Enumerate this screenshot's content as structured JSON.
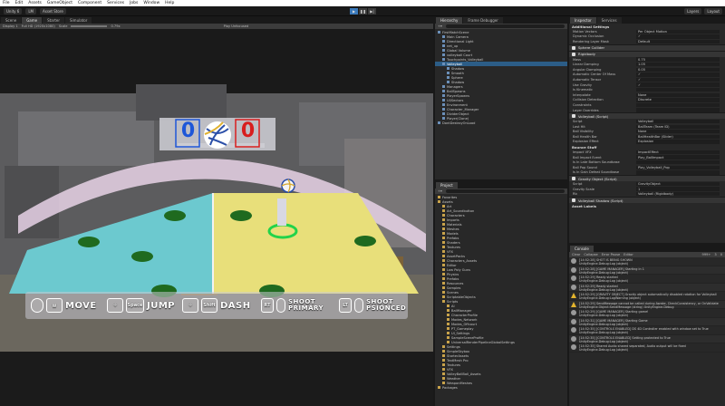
{
  "menu": [
    "File",
    "Edit",
    "Assets",
    "GameObject",
    "Component",
    "Services",
    "Jobs",
    "Window",
    "Help"
  ],
  "toolbar": {
    "account": "Unity 6",
    "cloud": "LM",
    "asset_store": "Asset Store",
    "layers": "Layers",
    "layout": "Layout"
  },
  "scene_tabs": [
    "Scene",
    "Game",
    "Starter",
    "Simulator"
  ],
  "game_bar": {
    "display": "Display 1",
    "resolution": "Full HD (1920x1080)",
    "scale_label": "Scale",
    "scale_value": "0.79x",
    "play_focused": "Play Unfocused"
  },
  "hud": {
    "score_left": "0",
    "score_right": "0",
    "move": "MOVE",
    "jump_key": "Space",
    "jump": "JUMP",
    "dash_key": "Shift",
    "dash": "DASH",
    "rt": "RT",
    "shoot_primary_1": "SHOOT",
    "shoot_primary_2": "PRIMARY",
    "lt": "LT",
    "shoot_2_1": "SHOOT",
    "shoot_2_2": "PSIONCED",
    "colors": {
      "blue": "#1e57d8",
      "red": "#d81e1e",
      "court_left": "#6cc9cf",
      "court_right": "#e8df7a",
      "pad": "#1f6a1f",
      "ring": "#22d34a"
    }
  },
  "hierarchy": {
    "tabs": [
      "Hierarchy",
      "Frame Debugger"
    ],
    "rows": [
      {
        "label": "FirstMatchScene",
        "depth": 0
      },
      {
        "label": "Main Camera",
        "depth": 1
      },
      {
        "label": "Directional Light",
        "depth": 1
      },
      {
        "label": "net_up",
        "depth": 1
      },
      {
        "label": "Global Volume",
        "depth": 1
      },
      {
        "label": "volleyball Court",
        "depth": 1
      },
      {
        "label": "Touchpoints_Volleyball",
        "depth": 1
      },
      {
        "label": "Volleyball",
        "depth": 1
      },
      {
        "label": "Shadow",
        "depth": 2
      },
      {
        "label": "Smooth",
        "depth": 2
      },
      {
        "label": "Sphere",
        "depth": 2
      },
      {
        "label": "Shadow",
        "depth": 2
      },
      {
        "label": "Managers",
        "depth": 1
      },
      {
        "label": "BallSpawns",
        "depth": 1
      },
      {
        "label": "PlayerSpawns",
        "depth": 1
      },
      {
        "label": "UI/Sectors",
        "depth": 1
      },
      {
        "label": "Environment",
        "depth": 1
      },
      {
        "label": "Character_Manager",
        "depth": 1
      },
      {
        "label": "DividerObject",
        "depth": 1
      },
      {
        "label": "Player(Clone)",
        "depth": 1
      },
      {
        "label": "DontDestroyOnLoad",
        "depth": 0
      }
    ]
  },
  "project": {
    "tabs": [
      "Project",
      "Console"
    ],
    "search_placeholder": "",
    "rows": [
      {
        "label": "Favorites",
        "depth": 0
      },
      {
        "label": "Assets",
        "depth": 0
      },
      {
        "label": "Art",
        "depth": 1
      },
      {
        "label": "Art_Soundbutton",
        "depth": 1
      },
      {
        "label": "Characters",
        "depth": 1
      },
      {
        "label": "Imports",
        "depth": 1
      },
      {
        "label": "Materials",
        "depth": 1
      },
      {
        "label": "Meshes",
        "depth": 1
      },
      {
        "label": "Models",
        "depth": 1
      },
      {
        "label": "Prefabs",
        "depth": 1
      },
      {
        "label": "Shaders",
        "depth": 1
      },
      {
        "label": "Textures",
        "depth": 1
      },
      {
        "label": "VFX",
        "depth": 1
      },
      {
        "label": "AssetPacks",
        "depth": 1
      },
      {
        "label": "Characters_Assets",
        "depth": 1
      },
      {
        "label": "Editor",
        "depth": 1
      },
      {
        "label": "Low Poly Guns",
        "depth": 1
      },
      {
        "label": "Physics",
        "depth": 1
      },
      {
        "label": "Prefabs",
        "depth": 1
      },
      {
        "label": "Resources",
        "depth": 1
      },
      {
        "label": "Samples",
        "depth": 1
      },
      {
        "label": "Scenes",
        "depth": 1
      },
      {
        "label": "ScriptableObjects",
        "depth": 1
      },
      {
        "label": "Scripts",
        "depth": 1
      },
      {
        "label": "AI",
        "depth": 2
      },
      {
        "label": "BallManager",
        "depth": 2
      },
      {
        "label": "CharacterProfile",
        "depth": 2
      },
      {
        "label": "Modes_Network",
        "depth": 2
      },
      {
        "label": "Modes_Offcourt",
        "depth": 2
      },
      {
        "label": "PT_Gameplay",
        "depth": 2
      },
      {
        "label": "UI_Settings",
        "depth": 2
      },
      {
        "label": "SampleSceneProfile",
        "depth": 2
      },
      {
        "label": "UniversalRenderPipelineGlobalSettings",
        "depth": 2
      },
      {
        "label": "Settings",
        "depth": 1
      },
      {
        "label": "SimpleSkybox",
        "depth": 1
      },
      {
        "label": "StarterAssets",
        "depth": 1
      },
      {
        "label": "TextMesh Pro",
        "depth": 1
      },
      {
        "label": "Textures",
        "depth": 1
      },
      {
        "label": "VFX",
        "depth": 1
      },
      {
        "label": "VolleyBallBall_Assets",
        "depth": 1
      },
      {
        "label": "Weather",
        "depth": 1
      },
      {
        "label": "WeaponMeshes",
        "depth": 1
      },
      {
        "label": "Packages",
        "depth": 0
      }
    ]
  },
  "inspector": {
    "tabs": [
      "Inspector",
      "Services"
    ],
    "sections": [
      {
        "type": "head",
        "label": "Additional Settings"
      },
      {
        "type": "row",
        "k": "Motion Vectors",
        "v": "Per Object Motion"
      },
      {
        "type": "row",
        "k": "Dynamic Occlusion",
        "v": "✓"
      },
      {
        "type": "row",
        "k": "Rendering Layer Mask",
        "v": "Default"
      },
      {
        "type": "comp",
        "label": "Sphere Collider"
      },
      {
        "type": "comp",
        "label": "Rigidbody"
      },
      {
        "type": "row",
        "k": "Mass",
        "v": "0.75"
      },
      {
        "type": "row",
        "k": "Linear Damping",
        "v": "1.05"
      },
      {
        "type": "row",
        "k": "Angular Damping",
        "v": "0.05"
      },
      {
        "type": "row",
        "k": "Automatic Center Of Mass",
        "v": "✓"
      },
      {
        "type": "row",
        "k": "Automatic Tensor",
        "v": "✓"
      },
      {
        "type": "row",
        "k": "Use Gravity",
        "v": "✓"
      },
      {
        "type": "row",
        "k": "Is Kinematic",
        "v": ""
      },
      {
        "type": "row",
        "k": "Interpolate",
        "v": "None"
      },
      {
        "type": "row",
        "k": "Collision Detection",
        "v": "Discrete"
      },
      {
        "type": "row",
        "k": "Constraints",
        "v": ""
      },
      {
        "type": "row",
        "k": "Layer Overrides",
        "v": ""
      },
      {
        "type": "comp",
        "label": "Volleyball (Script)"
      },
      {
        "type": "row",
        "k": "Script",
        "v": "Volleyball"
      },
      {
        "type": "row",
        "k": "Last Hit",
        "v": "BallTeam (Team ID)"
      },
      {
        "type": "row",
        "k": "Ball Visibility",
        "v": "None"
      },
      {
        "type": "row",
        "k": "Ball Health Bar",
        "v": "BallHealthBar (Slider)"
      },
      {
        "type": "row",
        "k": "Explosion Effect",
        "v": "Explosion"
      },
      {
        "type": "head",
        "label": "Bounce Stuff"
      },
      {
        "type": "row",
        "k": "Impact VFX",
        "v": "ImpactEffect"
      },
      {
        "type": "row",
        "k": "Ball Impact Event",
        "v": "Play_BallImpact"
      },
      {
        "type": "row",
        "k": "Is In Late Bottom Soundbase",
        "v": ""
      },
      {
        "type": "row",
        "k": "Ball Pop Sound",
        "v": "Play_Volleyball_Pop"
      },
      {
        "type": "row",
        "k": "Is In Gain Defeat Soundbase",
        "v": ""
      },
      {
        "type": "comp",
        "label": "Gravity Object (Script)"
      },
      {
        "type": "row",
        "k": "Script",
        "v": "GravityObject"
      },
      {
        "type": "row",
        "k": "Gravity Scale",
        "v": "1"
      },
      {
        "type": "row",
        "k": "Rb",
        "v": "Volleyball (Rigidbody)"
      },
      {
        "type": "comp",
        "label": "Volleyball Shadow (Script)"
      },
      {
        "type": "head",
        "label": "Asset Labels"
      }
    ]
  },
  "console": {
    "tab": "Console",
    "buttons": [
      "Clear",
      "Collapse",
      "Error Pause",
      "Editor"
    ],
    "counts": [
      "999+",
      "3",
      "0"
    ],
    "logs": [
      {
        "kind": "info",
        "t1": "[14:52:28] SHOT IS BEING SHOWN",
        "t2": "UnityEngine.Debug:Log (object)"
      },
      {
        "kind": "info",
        "t1": "[14:52:28] [GAME MANAGER] Starting in 1",
        "t2": "UnityEngine.Debug:Log (object)"
      },
      {
        "kind": "info",
        "t1": "[14:52:29] Ready started",
        "t2": "UnityEngine.Debug:Log (object)"
      },
      {
        "kind": "info",
        "t1": "[14:52:29] Ready started",
        "t2": "UnityEngine.Debug:Log (object)"
      },
      {
        "kind": "warn",
        "t1": "[14:52:29] [GRAVITY OBJECT] Gravity object automatically disabled rotation for Volleyball",
        "t2": "UnityEngine.Debug:LogWarning (object)"
      },
      {
        "kind": "warn",
        "t1": "[14:52:29] SendMessage cannot be called during Awake, CheckConsistency, or OnValidate",
        "t2": "UnityEngine.Object:SendMessage (string) UnityEngine.Debug"
      },
      {
        "kind": "info",
        "t1": "[14:52:29] [GAME MANAGER] Starting game!",
        "t2": "UnityEngine.Debug:Log (object)"
      },
      {
        "kind": "info",
        "t1": "[14:52:31] [GAME MANAGER] Starting Game",
        "t2": "UnityEngine.Debug:Log (object)"
      },
      {
        "kind": "info",
        "t1": "[14:52:35] [CONTROLS ENABLED] DS 4D Controller enabled with window set to True",
        "t2": "UnityEngine.Debug:Log (object)"
      },
      {
        "kind": "info",
        "t1": "[14:52:35] [CONTROLS ENABLED] Setting protected to True",
        "t2": "UnityEngine.Debug:Log (object)"
      },
      {
        "kind": "info",
        "t1": "[14:52:35] Shared Audio shared separated, Audio output will be fixed",
        "t2": "UnityEngine.Debug:Log (object)"
      }
    ]
  }
}
